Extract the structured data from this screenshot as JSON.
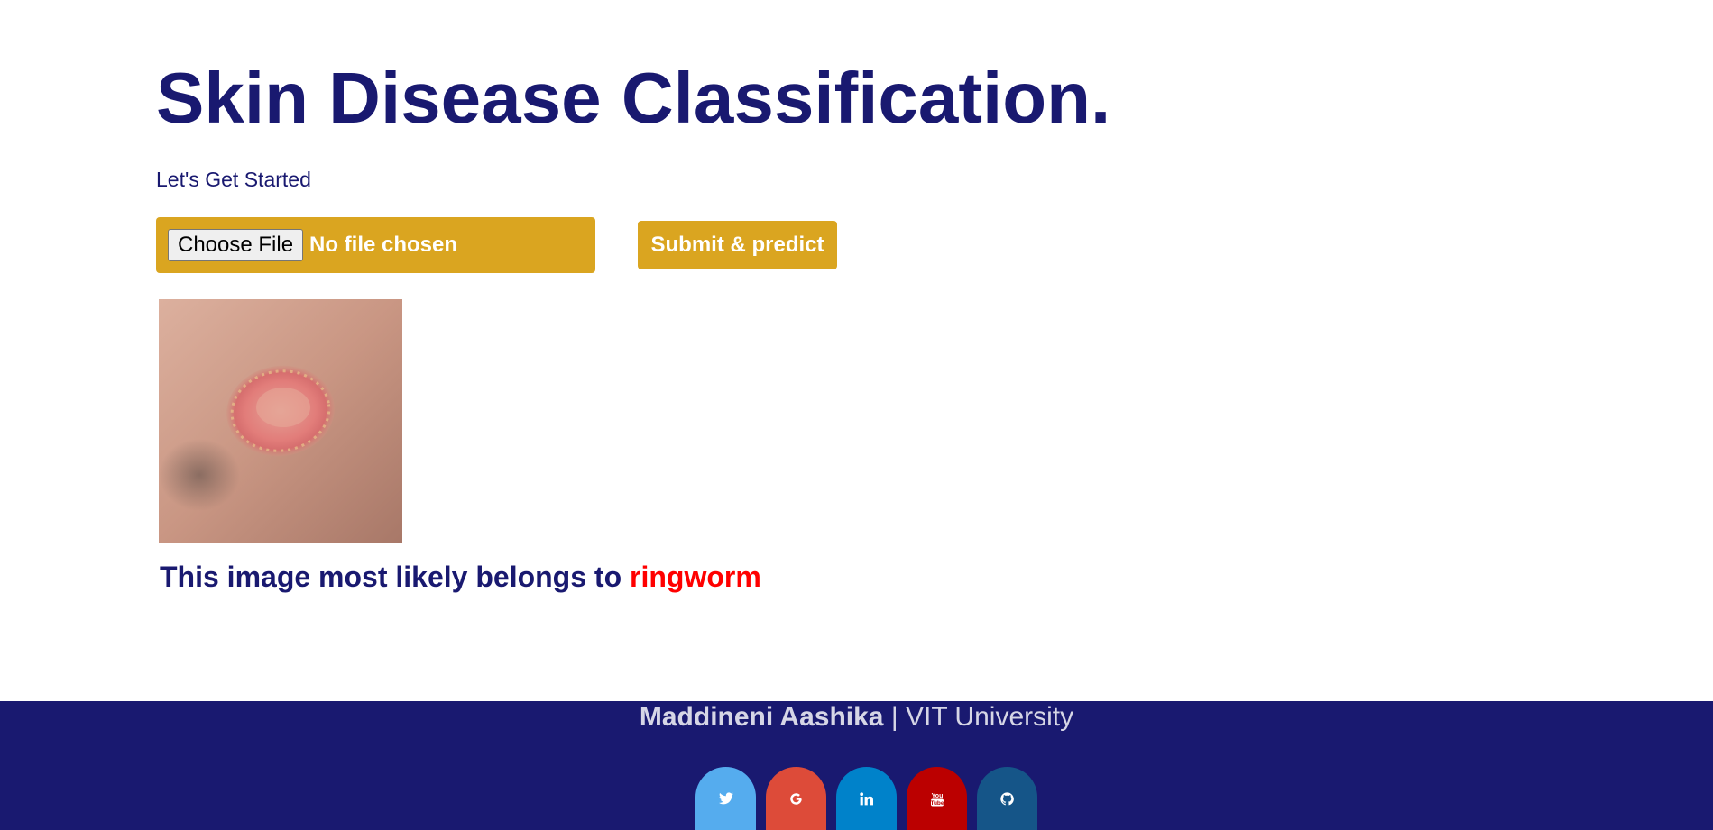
{
  "page": {
    "title": "Skin Disease Classification.",
    "subtitle": "Let's Get Started"
  },
  "upload": {
    "choose_file_label": "Choose File",
    "file_status": "No file chosen",
    "submit_label": "Submit & predict"
  },
  "result": {
    "prefix": "This image most likely belongs to ",
    "predicted_class": "ringworm"
  },
  "footer": {
    "author": "Maddineni Aashika",
    "separator": " | ",
    "institution": "VIT University",
    "socials": [
      {
        "icon": "twitter-icon",
        "color": "#55acee"
      },
      {
        "icon": "google-icon",
        "color": "#dd4b39"
      },
      {
        "icon": "linkedin-icon",
        "color": "#0082ca"
      },
      {
        "icon": "youtube-icon",
        "color": "#bb0000"
      },
      {
        "icon": "github-icon",
        "color": "#155588"
      }
    ]
  },
  "colors": {
    "primary": "#191970",
    "accent": "#daa520",
    "prediction": "#ff0000"
  }
}
